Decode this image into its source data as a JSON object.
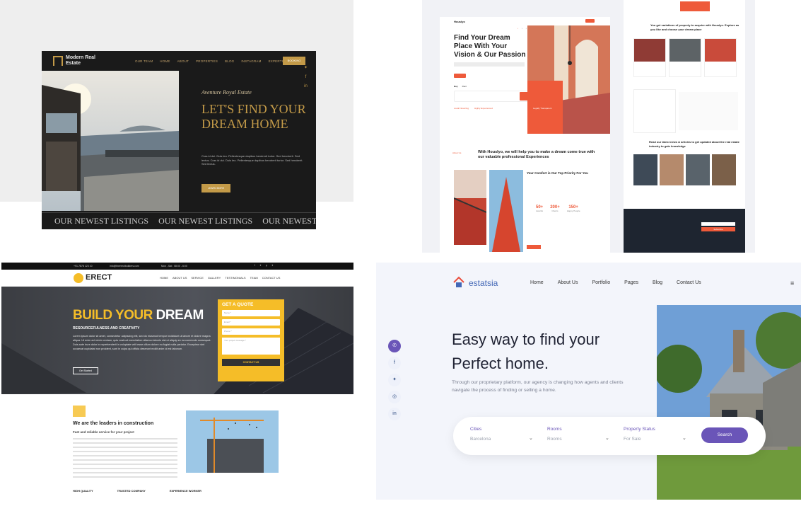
{
  "panel1": {
    "logo": "Modern Real Estate",
    "nav": [
      "OUR TEAM",
      "HOME",
      "ABOUT",
      "PROPERTIES",
      "BLOG",
      "INSTAGRAM",
      "EXPERTISE"
    ],
    "header_button": "BOOKING",
    "script_title": "Aventure Royal Estate",
    "headline": "LET'S FIND YOUR DREAM HOME",
    "description": "Cras id dui. Duis leo. Pellentesque dapibus hendrerit tortor. Sed hendrerit. Sed lectus. Cras id dui. Duis leo. Pellentesque dapibus hendrerit tortor. Sed hendrerit. Sed lectus.",
    "cta": "LEARN MORE",
    "marquee": [
      "OUR NEWEST LISTINGS",
      "OUR NEWEST LISTINGS",
      "OUR NEWEST LISTINGS"
    ],
    "social_icons": [
      "twitter-icon",
      "facebook-icon",
      "linkedin-icon"
    ]
  },
  "panel2": {
    "brand": "Houslyo",
    "headline": "Find Your Dream Place With Your Vision & Our Passion",
    "tabs": [
      "Buy",
      "Rent"
    ],
    "feature_titles": [
      "Local Financing",
      "Highly Experienced",
      "Legally Transparent"
    ],
    "about_tag": "About Us",
    "about_heading": "With Houslyo, we will help you to make a dream come true with our valuable professional Experiences",
    "comfort_heading": "Your Comfort is Our Top Priority For You",
    "stats": [
      {
        "value": "50+",
        "label": "Awards"
      },
      {
        "value": "200+",
        "label": "Clients"
      },
      {
        "value": "150+",
        "label": "Happy People"
      }
    ],
    "variations_heading": "You get variations of property to acquire with Houslyo. Explore as you like and choose your dream place",
    "news_heading": "Read our latest news & articles to get updated about the real estate industry to gain knowledge",
    "subscribe_button": "Subscribe"
  },
  "panel3": {
    "phone": "+91-7878 123 10",
    "email": "info@theerectbuilders.com",
    "hours": "Mon - Sat : 08:00 - 6:00",
    "logo": "ERECT",
    "nav": [
      "HOME",
      "ABOUT US",
      "SERVICE",
      "GALLERY",
      "TESTIMONIALS",
      "TEAM",
      "CONTACT US"
    ],
    "hero_title_accent": "BUILD YOUR",
    "hero_title_rest": " DREAM",
    "hero_subtitle": "RESOURCEFULNESS AND CREATIVITY",
    "hero_text": "Lorem ipsum dolor sit amet, consectetur adipiscing elit, sed do eiusmod tempor incididunt ut labore et dolore magna aliqua. Ut enim ad minim veniam, quis nostrud exercitation ullamco laboris nisi ut aliquip ex ea commodo consequat. Duis aute irure dolor in reprehenderit in voluptate velit esse cillum dolore eu fugiat nulla pariatur. Excepteur sint occaecat cupidatat non proident, sunt in culpa qui officia deserunt mollit anim id est laborum.",
    "hero_button": "Get Started",
    "quote_title": "GET A QUOTE",
    "quote_fields": [
      "Name *",
      "Email *",
      "Phone *"
    ],
    "quote_message": "Your project message *",
    "quote_submit": "CONTACT US",
    "leaders_title": "We are the leaders in construction",
    "leaders_subtitle": "Fast and reliable service for your project",
    "features": [
      "HIGH QUALITY",
      "TRUSTED COMPANY",
      "EXPERIENCE WORKER"
    ]
  },
  "panel4": {
    "logo": "estatsia",
    "nav": [
      "Home",
      "About Us",
      "Portfolio",
      "Pages",
      "Blog",
      "Contact Us"
    ],
    "headline_line1": "Easy way to find your",
    "headline_line2": "Perfect home.",
    "paragraph": "Through our proprietary platform, our agency is changing how agents and clients navigate the process of finding or selling a home.",
    "search": {
      "cities_label": "Cities",
      "cities_value": "Barcelona",
      "rooms_label": "Rooms",
      "rooms_value": "Rooms",
      "status_label": "Property Status",
      "status_value": "For Sale",
      "button": "Search"
    },
    "side_icons": [
      "phone-icon",
      "facebook-icon",
      "twitter-icon",
      "instagram-icon",
      "linkedin-icon"
    ],
    "accent": "#6a55b8"
  }
}
